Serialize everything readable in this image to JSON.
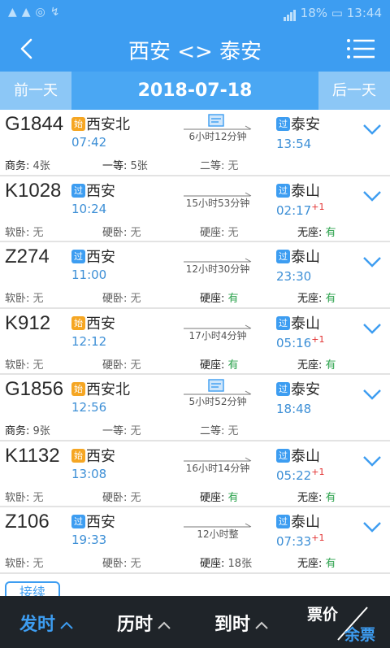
{
  "status": {
    "left_icons": "▲▲◎↯",
    "battery": "18%",
    "time": "13:44"
  },
  "header": {
    "title": "西安 <> 泰安"
  },
  "datebar": {
    "prev": "前一天",
    "date": "2018-07-18",
    "next": "后一天"
  },
  "trains": [
    {
      "number": "G1844",
      "from_type": "始",
      "from": "西安北",
      "dep": "07:42",
      "duration": "6小时12分钟",
      "to_type": "过",
      "to": "泰安",
      "arr": "13:54",
      "next_day": "",
      "has_ticket_icon": true,
      "seats": [
        {
          "k": "商务:",
          "v": "4张"
        },
        {
          "k": "一等:",
          "v": "5张"
        },
        {
          "k": "二等:",
          "v": "无"
        }
      ]
    },
    {
      "number": "K1028",
      "from_type": "过",
      "from": "西安",
      "dep": "10:24",
      "duration": "15小时53分钟",
      "to_type": "过",
      "to": "泰山",
      "arr": "02:17",
      "next_day": "+1",
      "has_ticket_icon": false,
      "seats": [
        {
          "k": "软卧:",
          "v": "无"
        },
        {
          "k": "硬卧:",
          "v": "无"
        },
        {
          "k": "硬座:",
          "v": "无"
        },
        {
          "k": "无座:",
          "v": "有"
        }
      ]
    },
    {
      "number": "Z274",
      "from_type": "过",
      "from": "西安",
      "dep": "11:00",
      "duration": "12小时30分钟",
      "to_type": "过",
      "to": "泰山",
      "arr": "23:30",
      "next_day": "",
      "has_ticket_icon": false,
      "seats": [
        {
          "k": "软卧:",
          "v": "无"
        },
        {
          "k": "硬卧:",
          "v": "无"
        },
        {
          "k": "硬座:",
          "v": "有"
        },
        {
          "k": "无座:",
          "v": "有"
        }
      ]
    },
    {
      "number": "K912",
      "from_type": "始",
      "from": "西安",
      "dep": "12:12",
      "duration": "17小时4分钟",
      "to_type": "过",
      "to": "泰山",
      "arr": "05:16",
      "next_day": "+1",
      "has_ticket_icon": false,
      "seats": [
        {
          "k": "软卧:",
          "v": "无"
        },
        {
          "k": "硬卧:",
          "v": "无"
        },
        {
          "k": "硬座:",
          "v": "有"
        },
        {
          "k": "无座:",
          "v": "有"
        }
      ]
    },
    {
      "number": "G1856",
      "from_type": "始",
      "from": "西安北",
      "dep": "12:56",
      "duration": "5小时52分钟",
      "to_type": "过",
      "to": "泰安",
      "arr": "18:48",
      "next_day": "",
      "has_ticket_icon": true,
      "seats": [
        {
          "k": "商务:",
          "v": "9张"
        },
        {
          "k": "一等:",
          "v": "无"
        },
        {
          "k": "二等:",
          "v": "无"
        }
      ]
    },
    {
      "number": "K1132",
      "from_type": "始",
      "from": "西安",
      "dep": "13:08",
      "duration": "16小时14分钟",
      "to_type": "过",
      "to": "泰山",
      "arr": "05:22",
      "next_day": "+1",
      "has_ticket_icon": false,
      "seats": [
        {
          "k": "软卧:",
          "v": "无"
        },
        {
          "k": "硬卧:",
          "v": "无"
        },
        {
          "k": "硬座:",
          "v": "有"
        },
        {
          "k": "无座:",
          "v": "有"
        }
      ]
    },
    {
      "number": "Z106",
      "from_type": "过",
      "from": "西安",
      "dep": "19:33",
      "duration": "12小时整",
      "to_type": "过",
      "to": "泰山",
      "arr": "07:33",
      "next_day": "+1",
      "has_ticket_icon": false,
      "seats": [
        {
          "k": "软卧:",
          "v": "无"
        },
        {
          "k": "硬卧:",
          "v": "无"
        },
        {
          "k": "硬座:",
          "v": "18张"
        },
        {
          "k": "无座:",
          "v": "有"
        }
      ]
    }
  ],
  "transfer_label": "接续",
  "bottom": {
    "depart": "发时",
    "duration": "历时",
    "arrive": "到时",
    "price": "票价",
    "remain": "余票"
  },
  "colors": {
    "accent": "#3d9df1",
    "available": "#2ba24c",
    "start_badge": "#f5a623",
    "next_day": "#e23030",
    "bottom_bg": "#1f2429"
  }
}
